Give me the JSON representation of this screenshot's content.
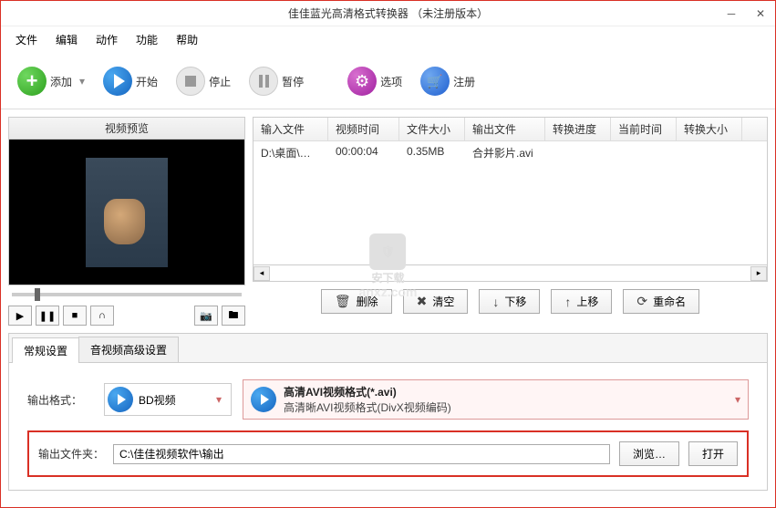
{
  "window": {
    "title": "佳佳蓝光高清格式转换器  （未注册版本）"
  },
  "menu": {
    "file": "文件",
    "edit": "编辑",
    "action": "动作",
    "function": "功能",
    "help": "帮助"
  },
  "toolbar": {
    "add": "添加",
    "start": "开始",
    "stop": "停止",
    "pause": "暂停",
    "options": "选项",
    "register": "注册"
  },
  "preview": {
    "title": "视频预览"
  },
  "table": {
    "headers": {
      "input": "输入文件",
      "duration": "视频时间",
      "size": "文件大小",
      "output": "输出文件",
      "progress": "转换进度",
      "current": "当前时间",
      "convsize": "转换大小"
    },
    "rows": [
      {
        "input": "D:\\桌面\\说…",
        "duration": "00:00:04",
        "size": "0.35MB",
        "output": "合并影片.avi",
        "progress": "",
        "current": "",
        "convsize": ""
      }
    ]
  },
  "actions": {
    "delete": "删除",
    "clear": "清空",
    "down": "下移",
    "up": "上移",
    "rename": "重命名"
  },
  "tabs": {
    "general": "常规设置",
    "advanced": "音视频高级设置"
  },
  "settings": {
    "output_format_label": "输出格式：",
    "format_category": "BD视频",
    "format_title": "高清AVI视频格式(*.avi)",
    "format_sub": "高清晰AVI视频格式(DivX视频编码)",
    "output_folder_label": "输出文件夹：",
    "output_folder_value": "C:\\佳佳视频软件\\输出",
    "browse": "浏览…",
    "open": "打开"
  },
  "watermark": {
    "brand": "安下载",
    "domain": "anxz.com"
  }
}
